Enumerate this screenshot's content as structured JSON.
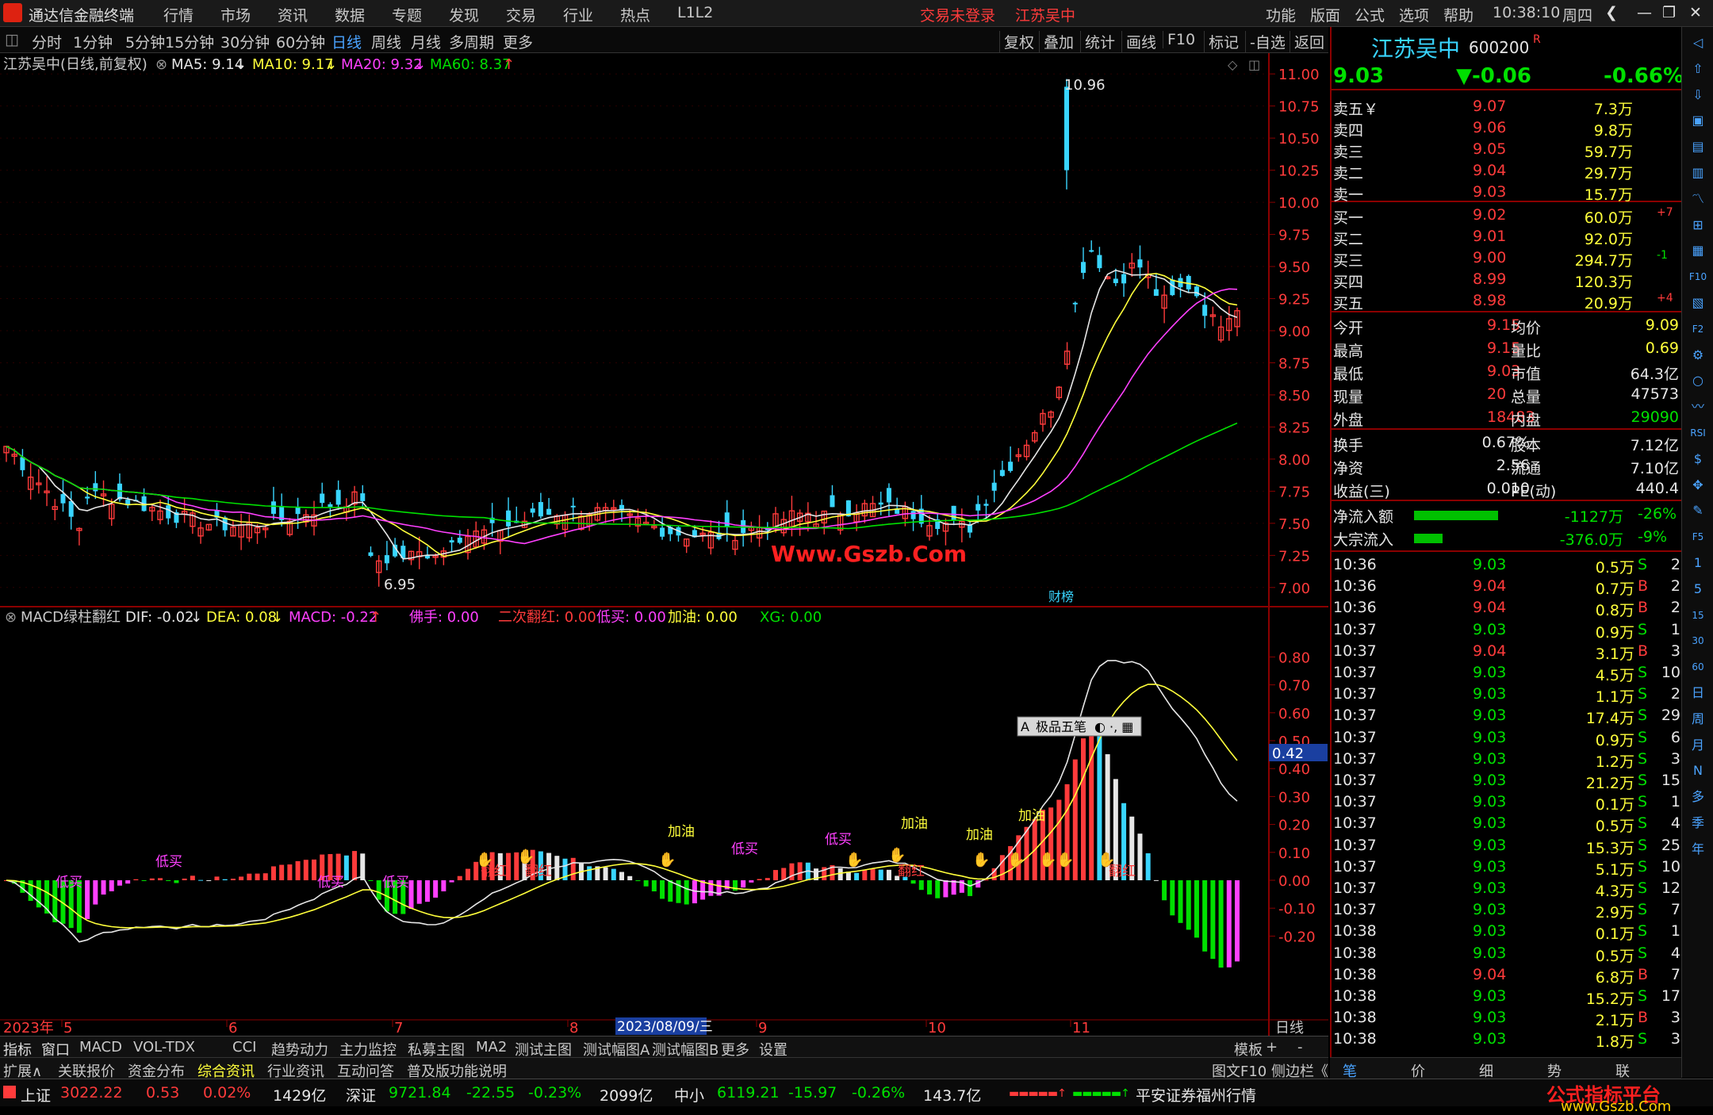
{
  "app": {
    "title": "通达信金融终端",
    "menu": [
      "行情",
      "市场",
      "资讯",
      "数据",
      "专题",
      "发现",
      "交易",
      "行业",
      "热点",
      "L1L2"
    ],
    "login_status": "交易未登录",
    "stock_name": "江苏吴中",
    "right_menu": [
      "功能",
      "版面",
      "公式",
      "选项",
      "帮助"
    ],
    "time": "10:38:10",
    "weekday": "周四"
  },
  "toolbar": {
    "periods": [
      "分时",
      "1分钟",
      "5分钟",
      "15分钟",
      "30分钟",
      "60分钟",
      "日线",
      "周线",
      "月线",
      "多周期",
      "更多"
    ],
    "active": "日线",
    "buttons": [
      "复权",
      "叠加",
      "统计",
      "画线",
      "F10",
      "标记",
      "-自选",
      "返回"
    ]
  },
  "main_chart": {
    "legend": "江苏吴中(日线,前复权)",
    "ma5": "MA5: 9.14",
    "ma10": "MA10: 9.17",
    "ma20": "MA20: 9.32",
    "ma60": "MA60: 8.37",
    "price_high_label": "10.96",
    "price_low_label": "6.95",
    "watermark": "Www.Gszb.Com",
    "tag": "财榜",
    "y_ticks": [
      "11.00",
      "10.75",
      "10.50",
      "10.25",
      "10.00",
      "9.75",
      "9.50",
      "9.25",
      "9.00",
      "8.75",
      "8.50",
      "8.25",
      "8.00",
      "7.75",
      "7.50",
      "7.25",
      "7.00"
    ]
  },
  "sub_chart": {
    "legend": "MACD绿柱翻红",
    "dif": "DIF: -0.02",
    "dea": "DEA: 0.08",
    "macd": "MACD: -0.22",
    "foshou": "佛手: 0.00",
    "second": "二次翻红: 0.00",
    "dimai": "低买: 0.00",
    "jiayou": "加油: 0.00",
    "xg": "XG: 0.00",
    "y_ticks": [
      "0.80",
      "0.70",
      "0.60",
      "0.50",
      "0.40",
      "0.30",
      "0.20",
      "0.10",
      "0.00",
      "-0.10",
      "-0.20"
    ],
    "cursor_value": "0.42",
    "ime": "极品五笔",
    "signals": {
      "dimai": "低买",
      "fanhong": "翻红",
      "jiayou": "加油"
    }
  },
  "x_axis": {
    "year": "2023年",
    "months": [
      "5",
      "6",
      "7",
      "8",
      "9",
      "10",
      "11"
    ],
    "cursor_date": "2023/08/09/三",
    "period": "日线"
  },
  "bottom_tabs": [
    "指标",
    "窗口",
    "MACD",
    "VOL-TDX",
    "CCI",
    "趋势动力",
    "主力监控",
    "私募主图",
    "MA2",
    "测试主图",
    "测试幅图A",
    "测试幅图B",
    "更多",
    "设置"
  ],
  "bottom_tabs_right": [
    "模板",
    "+",
    "-"
  ],
  "bottom_tabs2": [
    "扩展∧",
    "关联报价",
    "资金分布",
    "综合资讯",
    "行业资讯",
    "互动问答",
    "普及版功能说明"
  ],
  "bottom_tabs2_right": "图文F10 侧边栏《",
  "quote": {
    "name": "江苏吴中",
    "code": "600200",
    "flag": "R",
    "price": "9.03",
    "change": "▼-0.06",
    "pct": "-0.66%",
    "asks": [
      [
        "卖五￥",
        "9.07",
        "7.3万"
      ],
      [
        "卖四",
        "9.06",
        "9.8万"
      ],
      [
        "卖三",
        "9.05",
        "59.7万"
      ],
      [
        "卖二",
        "9.04",
        "29.7万"
      ],
      [
        "卖一",
        "9.03",
        "15.7万"
      ]
    ],
    "bids": [
      [
        "买一",
        "9.02",
        "60.0万",
        "+7"
      ],
      [
        "买二",
        "9.01",
        "92.0万",
        ""
      ],
      [
        "买三",
        "9.00",
        "294.7万",
        "-1"
      ],
      [
        "买四",
        "8.99",
        "120.3万",
        ""
      ],
      [
        "买五",
        "8.98",
        "20.9万",
        "+4"
      ]
    ],
    "stats": [
      [
        "今开",
        "9.15",
        "均价",
        "9.09"
      ],
      [
        "最高",
        "9.15",
        "量比",
        "0.69"
      ],
      [
        "最低",
        "9.03",
        "市值",
        "64.3亿"
      ],
      [
        "现量",
        "20",
        "总量",
        "47573"
      ],
      [
        "外盘",
        "18483",
        "内盘",
        "29090"
      ]
    ],
    "stats2": [
      [
        "换手",
        "0.67%",
        "股本",
        "7.12亿"
      ],
      [
        "净资",
        "2.56",
        "流通",
        "7.10亿"
      ],
      [
        "收益(三)",
        "0.010",
        "PE(动)",
        "440.4"
      ]
    ],
    "flow": [
      [
        "净流入额",
        "-1127万",
        "-26%"
      ],
      [
        "大宗流入",
        "-376.0万",
        "-9%"
      ]
    ],
    "ticks": [
      [
        "10:36",
        "9.03",
        "0.5万",
        "S",
        "2"
      ],
      [
        "10:36",
        "9.04",
        "0.7万",
        "B",
        "2"
      ],
      [
        "10:36",
        "9.04",
        "0.8万",
        "B",
        "2"
      ],
      [
        "10:37",
        "9.03",
        "0.9万",
        "S",
        "1"
      ],
      [
        "10:37",
        "9.04",
        "3.1万",
        "B",
        "3"
      ],
      [
        "10:37",
        "9.03",
        "4.5万",
        "S",
        "10"
      ],
      [
        "10:37",
        "9.03",
        "1.1万",
        "S",
        "2"
      ],
      [
        "10:37",
        "9.03",
        "17.4万",
        "S",
        "29"
      ],
      [
        "10:37",
        "9.03",
        "0.9万",
        "S",
        "6"
      ],
      [
        "10:37",
        "9.03",
        "1.2万",
        "S",
        "3"
      ],
      [
        "10:37",
        "9.03",
        "21.2万",
        "S",
        "15"
      ],
      [
        "10:37",
        "9.03",
        "0.1万",
        "S",
        "1"
      ],
      [
        "10:37",
        "9.03",
        "0.5万",
        "S",
        "4"
      ],
      [
        "10:37",
        "9.03",
        "15.3万",
        "S",
        "25"
      ],
      [
        "10:37",
        "9.03",
        "5.1万",
        "S",
        "10"
      ],
      [
        "10:37",
        "9.03",
        "4.3万",
        "S",
        "12"
      ],
      [
        "10:37",
        "9.03",
        "2.9万",
        "S",
        "7"
      ],
      [
        "10:38",
        "9.03",
        "0.1万",
        "S",
        "1"
      ],
      [
        "10:38",
        "9.03",
        "0.5万",
        "S",
        "4"
      ],
      [
        "10:38",
        "9.04",
        "6.8万",
        "B",
        "7"
      ],
      [
        "10:38",
        "9.03",
        "15.2万",
        "S",
        "17"
      ],
      [
        "10:38",
        "9.03",
        "2.1万",
        "B",
        "3"
      ],
      [
        "10:38",
        "9.03",
        "1.8万",
        "S",
        "3"
      ]
    ],
    "tabs": [
      "笔",
      "价",
      "细",
      "势",
      "联"
    ]
  },
  "side_icons": [
    "◁",
    "⇧",
    "⇩",
    "▣",
    "▤",
    "▥",
    "〽",
    "⊞",
    "▦",
    "F10",
    "▧",
    "F2",
    "⚙",
    "○",
    "〰",
    "RSI",
    "$",
    "✥",
    "✎",
    "F5",
    "1",
    "5",
    "15",
    "30",
    "60",
    "日",
    "周",
    "月",
    "N",
    "多",
    "季",
    "年"
  ],
  "status": {
    "sh_name": "上证",
    "sh_val": "3022.22",
    "sh_chg": "0.53",
    "sh_pct": "0.02%",
    "sh_amt": "1429亿",
    "sz_name": "深证",
    "sz_val": "9721.84",
    "sz_chg": "-22.55",
    "sz_pct": "-0.23%",
    "sz_amt": "2099亿",
    "zx_name": "中小",
    "zx_val": "6119.21",
    "zx_chg": "-15.97",
    "zx_pct": "-0.26%",
    "zx_amt": "143.7亿",
    "broker": "平安证券福州行情",
    "brand": "公式指标平台",
    "brand_url": "www.Gszb.Com"
  }
}
